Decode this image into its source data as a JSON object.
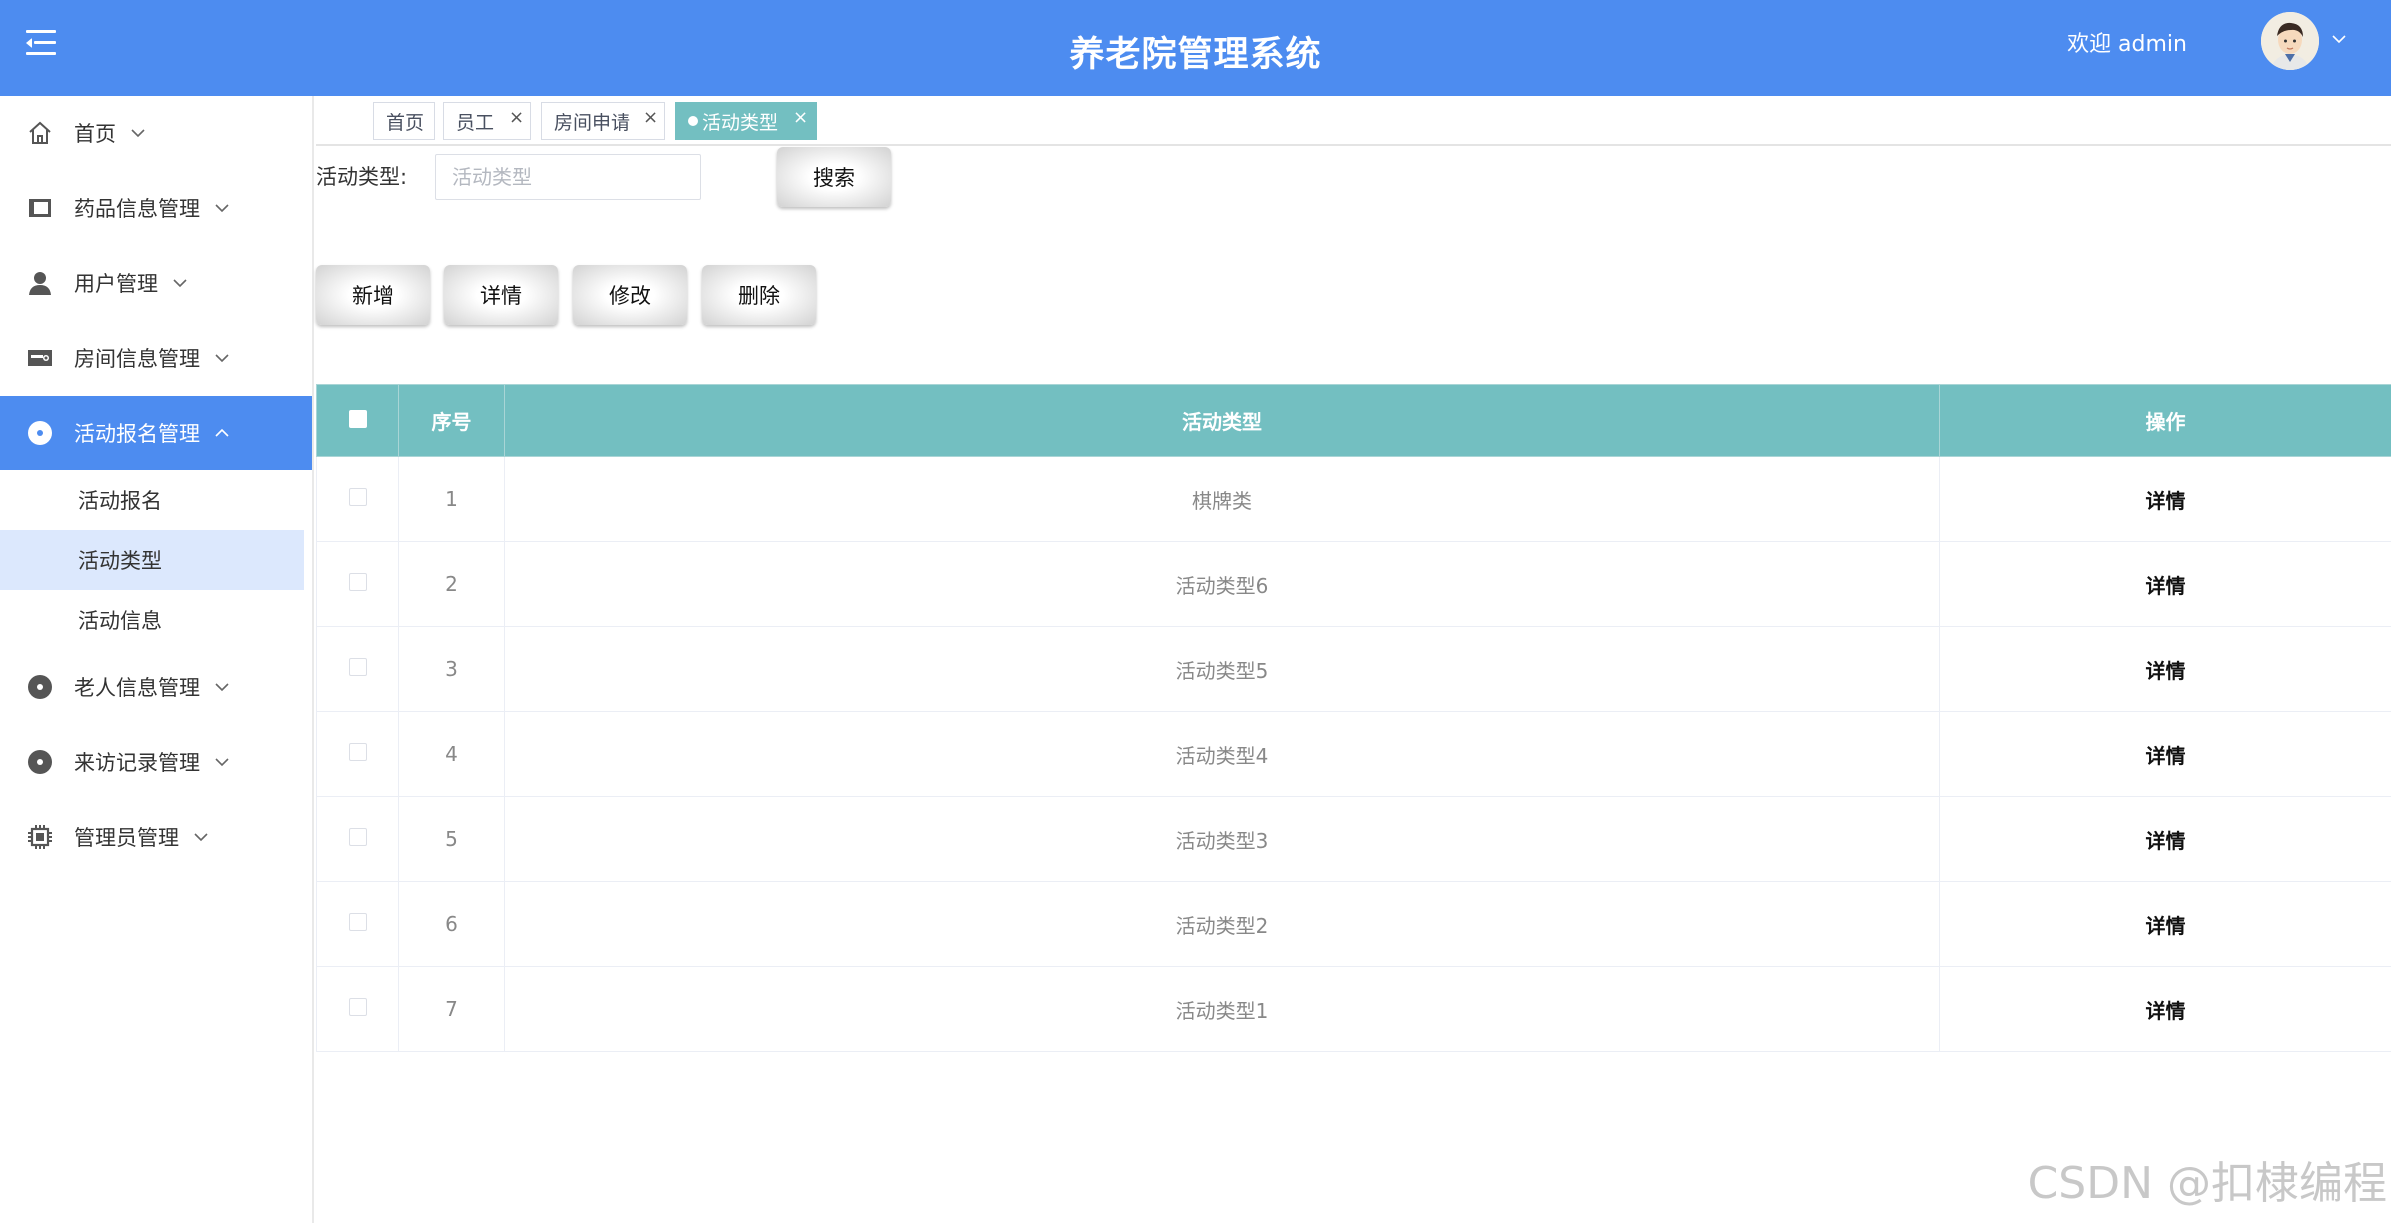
{
  "header": {
    "title": "养老院管理系统",
    "welcome": "欢迎 admin",
    "menu_icon": "hamburger-menu-icon",
    "avatar_icon": "user-avatar",
    "accent_color": "#4d8cf0"
  },
  "sidebar": {
    "items": [
      {
        "label": "首页",
        "icon": "home-icon"
      },
      {
        "label": "药品信息管理",
        "icon": "book-icon"
      },
      {
        "label": "用户管理",
        "icon": "user-icon"
      },
      {
        "label": "房间信息管理",
        "icon": "room-icon"
      },
      {
        "label": "活动报名管理",
        "icon": "disc-icon",
        "active": true
      },
      {
        "label": "老人信息管理",
        "icon": "disc-icon"
      },
      {
        "label": "来访记录管理",
        "icon": "disc-icon"
      },
      {
        "label": "管理员管理",
        "icon": "chip-icon"
      }
    ],
    "subitems": [
      {
        "label": "活动报名"
      },
      {
        "label": "活动类型",
        "active": true
      },
      {
        "label": "活动信息"
      }
    ]
  },
  "tabs": [
    {
      "label": "首页"
    },
    {
      "label": "员工"
    },
    {
      "label": "房间申请"
    },
    {
      "label": "活动类型",
      "active": true
    }
  ],
  "search": {
    "label": "活动类型:",
    "placeholder": "活动类型",
    "value": "",
    "button": "搜索"
  },
  "actions": {
    "add": "新增",
    "detail": "详情",
    "edit": "修改",
    "delete": "删除"
  },
  "table": {
    "columns": [
      "序号",
      "活动类型",
      "操作"
    ],
    "header_color": "#73bfc1",
    "rows": [
      {
        "no": "1",
        "type": "棋牌类",
        "op": "详情"
      },
      {
        "no": "2",
        "type": "活动类型6",
        "op": "详情"
      },
      {
        "no": "3",
        "type": "活动类型5",
        "op": "详情"
      },
      {
        "no": "4",
        "type": "活动类型4",
        "op": "详情"
      },
      {
        "no": "5",
        "type": "活动类型3",
        "op": "详情"
      },
      {
        "no": "6",
        "type": "活动类型2",
        "op": "详情"
      },
      {
        "no": "7",
        "type": "活动类型1",
        "op": "详情"
      }
    ]
  },
  "watermark": "CSDN @扣棣编程"
}
